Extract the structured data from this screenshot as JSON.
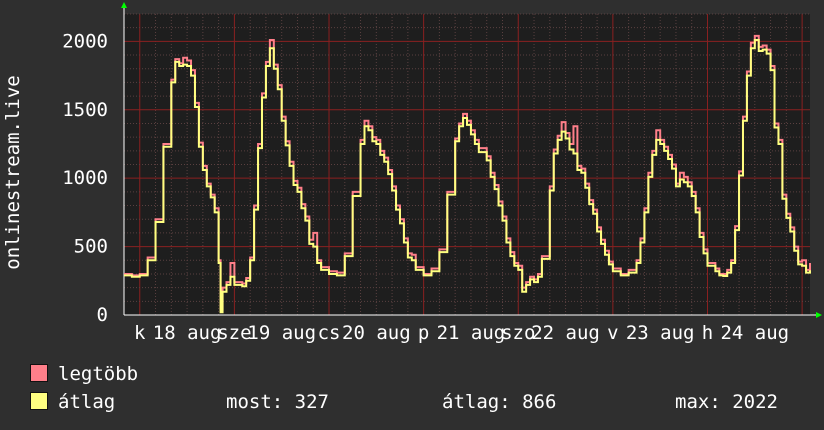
{
  "chart_data": {
    "type": "line",
    "ylabel": "onlinestream.live",
    "ylim": [
      0,
      2200
    ],
    "yticks": [
      0,
      500,
      1000,
      1500,
      2000
    ],
    "grid": true,
    "x_tick_labels": [
      "k",
      "18 aug",
      "sze",
      "19 aug",
      "cs",
      "20 aug",
      "p",
      "21 aug",
      "szo",
      "22 aug",
      "v",
      "23 aug",
      "h",
      "24 aug"
    ],
    "x_range_hours": [
      -4,
      164
    ],
    "series": [
      {
        "name": "legtöbb",
        "color": "#ff7f8a",
        "points": [
          [
            -4,
            300
          ],
          [
            -2,
            290
          ],
          [
            0,
            300
          ],
          [
            2,
            420
          ],
          [
            4,
            700
          ],
          [
            6,
            1250
          ],
          [
            8,
            1720
          ],
          [
            9,
            1870
          ],
          [
            10,
            1840
          ],
          [
            11,
            1880
          ],
          [
            12,
            1860
          ],
          [
            13,
            1790
          ],
          [
            14,
            1550
          ],
          [
            15,
            1260
          ],
          [
            16,
            1090
          ],
          [
            17,
            960
          ],
          [
            18,
            880
          ],
          [
            19,
            780
          ],
          [
            20,
            400
          ],
          [
            20.5,
            40
          ],
          [
            21,
            200
          ],
          [
            22,
            240
          ],
          [
            23,
            380
          ],
          [
            24,
            240
          ],
          [
            25,
            240
          ],
          [
            26,
            230
          ],
          [
            27,
            270
          ],
          [
            28,
            420
          ],
          [
            29,
            800
          ],
          [
            30,
            1250
          ],
          [
            31,
            1620
          ],
          [
            32,
            1850
          ],
          [
            33,
            2010
          ],
          [
            34,
            1830
          ],
          [
            35,
            1680
          ],
          [
            36,
            1450
          ],
          [
            37,
            1270
          ],
          [
            38,
            1120
          ],
          [
            39,
            980
          ],
          [
            40,
            930
          ],
          [
            41,
            810
          ],
          [
            42,
            720
          ],
          [
            43,
            550
          ],
          [
            44,
            600
          ],
          [
            45,
            400
          ],
          [
            46,
            350
          ],
          [
            48,
            320
          ],
          [
            50,
            310
          ],
          [
            52,
            450
          ],
          [
            54,
            900
          ],
          [
            56,
            1280
          ],
          [
            57,
            1420
          ],
          [
            58,
            1380
          ],
          [
            59,
            1300
          ],
          [
            60,
            1280
          ],
          [
            61,
            1200
          ],
          [
            62,
            1150
          ],
          [
            63,
            1060
          ],
          [
            64,
            940
          ],
          [
            65,
            800
          ],
          [
            66,
            700
          ],
          [
            67,
            560
          ],
          [
            68,
            450
          ],
          [
            69,
            440
          ],
          [
            70,
            350
          ],
          [
            72,
            300
          ],
          [
            74,
            340
          ],
          [
            76,
            480
          ],
          [
            78,
            900
          ],
          [
            80,
            1290
          ],
          [
            81,
            1400
          ],
          [
            82,
            1470
          ],
          [
            83,
            1420
          ],
          [
            84,
            1350
          ],
          [
            85,
            1280
          ],
          [
            86,
            1220
          ],
          [
            88,
            1160
          ],
          [
            89,
            1040
          ],
          [
            90,
            950
          ],
          [
            91,
            830
          ],
          [
            92,
            720
          ],
          [
            93,
            560
          ],
          [
            94,
            460
          ],
          [
            95,
            380
          ],
          [
            96,
            360
          ],
          [
            97,
            200
          ],
          [
            98,
            240
          ],
          [
            99,
            280
          ],
          [
            100,
            260
          ],
          [
            101,
            300
          ],
          [
            102,
            430
          ],
          [
            104,
            940
          ],
          [
            105,
            1210
          ],
          [
            106,
            1310
          ],
          [
            107,
            1410
          ],
          [
            108,
            1330
          ],
          [
            109,
            1250
          ],
          [
            110,
            1380
          ],
          [
            111,
            1090
          ],
          [
            112,
            1070
          ],
          [
            113,
            960
          ],
          [
            114,
            840
          ],
          [
            115,
            770
          ],
          [
            116,
            640
          ],
          [
            117,
            550
          ],
          [
            118,
            470
          ],
          [
            119,
            390
          ],
          [
            120,
            340
          ],
          [
            122,
            300
          ],
          [
            124,
            330
          ],
          [
            126,
            400
          ],
          [
            127,
            560
          ],
          [
            128,
            780
          ],
          [
            129,
            1040
          ],
          [
            130,
            1200
          ],
          [
            131,
            1350
          ],
          [
            132,
            1280
          ],
          [
            133,
            1230
          ],
          [
            134,
            1170
          ],
          [
            135,
            1100
          ],
          [
            136,
            960
          ],
          [
            137,
            1040
          ],
          [
            138,
            1010
          ],
          [
            139,
            970
          ],
          [
            140,
            900
          ],
          [
            141,
            780
          ],
          [
            142,
            600
          ],
          [
            143,
            480
          ],
          [
            144,
            380
          ],
          [
            146,
            340
          ],
          [
            147,
            300
          ],
          [
            148,
            300
          ],
          [
            149,
            330
          ],
          [
            150,
            400
          ],
          [
            151,
            650
          ],
          [
            152,
            1050
          ],
          [
            153,
            1450
          ],
          [
            154,
            1780
          ],
          [
            155,
            1990
          ],
          [
            156,
            2040
          ],
          [
            157,
            1960
          ],
          [
            158,
            1970
          ],
          [
            159,
            1940
          ],
          [
            160,
            1820
          ],
          [
            161,
            1400
          ],
          [
            162,
            1280
          ],
          [
            163,
            880
          ],
          [
            164,
            740
          ],
          [
            165,
            640
          ],
          [
            166,
            500
          ],
          [
            167,
            390
          ],
          [
            168,
            400
          ],
          [
            169,
            330
          ],
          [
            170,
            380
          ]
        ]
      },
      {
        "name": "átlag",
        "color": "#ffff80",
        "points": [
          [
            -4,
            290
          ],
          [
            -2,
            280
          ],
          [
            0,
            290
          ],
          [
            2,
            400
          ],
          [
            4,
            680
          ],
          [
            6,
            1230
          ],
          [
            8,
            1700
          ],
          [
            9,
            1850
          ],
          [
            10,
            1820
          ],
          [
            11,
            1830
          ],
          [
            12,
            1820
          ],
          [
            13,
            1750
          ],
          [
            14,
            1520
          ],
          [
            15,
            1230
          ],
          [
            16,
            1060
          ],
          [
            17,
            940
          ],
          [
            18,
            860
          ],
          [
            19,
            750
          ],
          [
            20,
            380
          ],
          [
            20.5,
            20
          ],
          [
            21,
            170
          ],
          [
            22,
            220
          ],
          [
            23,
            280
          ],
          [
            24,
            220
          ],
          [
            25,
            220
          ],
          [
            26,
            210
          ],
          [
            27,
            250
          ],
          [
            28,
            400
          ],
          [
            29,
            770
          ],
          [
            30,
            1220
          ],
          [
            31,
            1590
          ],
          [
            32,
            1820
          ],
          [
            33,
            1950
          ],
          [
            34,
            1800
          ],
          [
            35,
            1650
          ],
          [
            36,
            1420
          ],
          [
            37,
            1240
          ],
          [
            38,
            1090
          ],
          [
            39,
            950
          ],
          [
            40,
            900
          ],
          [
            41,
            780
          ],
          [
            42,
            690
          ],
          [
            43,
            520
          ],
          [
            44,
            500
          ],
          [
            45,
            380
          ],
          [
            46,
            330
          ],
          [
            48,
            300
          ],
          [
            50,
            290
          ],
          [
            52,
            430
          ],
          [
            54,
            870
          ],
          [
            56,
            1250
          ],
          [
            57,
            1380
          ],
          [
            58,
            1350
          ],
          [
            59,
            1270
          ],
          [
            60,
            1250
          ],
          [
            61,
            1170
          ],
          [
            62,
            1120
          ],
          [
            63,
            1030
          ],
          [
            64,
            910
          ],
          [
            65,
            770
          ],
          [
            66,
            670
          ],
          [
            67,
            530
          ],
          [
            68,
            420
          ],
          [
            69,
            400
          ],
          [
            70,
            330
          ],
          [
            72,
            290
          ],
          [
            74,
            320
          ],
          [
            76,
            460
          ],
          [
            78,
            880
          ],
          [
            80,
            1270
          ],
          [
            81,
            1380
          ],
          [
            82,
            1440
          ],
          [
            83,
            1390
          ],
          [
            84,
            1320
          ],
          [
            85,
            1250
          ],
          [
            86,
            1190
          ],
          [
            88,
            1130
          ],
          [
            89,
            1010
          ],
          [
            90,
            920
          ],
          [
            91,
            800
          ],
          [
            92,
            690
          ],
          [
            93,
            530
          ],
          [
            94,
            430
          ],
          [
            95,
            360
          ],
          [
            96,
            330
          ],
          [
            97,
            170
          ],
          [
            98,
            220
          ],
          [
            99,
            260
          ],
          [
            100,
            240
          ],
          [
            101,
            280
          ],
          [
            102,
            410
          ],
          [
            104,
            910
          ],
          [
            105,
            1180
          ],
          [
            106,
            1280
          ],
          [
            107,
            1340
          ],
          [
            108,
            1290
          ],
          [
            109,
            1210
          ],
          [
            110,
            1180
          ],
          [
            111,
            1060
          ],
          [
            112,
            1040
          ],
          [
            113,
            930
          ],
          [
            114,
            810
          ],
          [
            115,
            740
          ],
          [
            116,
            610
          ],
          [
            117,
            520
          ],
          [
            118,
            440
          ],
          [
            119,
            370
          ],
          [
            120,
            320
          ],
          [
            122,
            290
          ],
          [
            124,
            310
          ],
          [
            126,
            380
          ],
          [
            127,
            530
          ],
          [
            128,
            750
          ],
          [
            129,
            1010
          ],
          [
            130,
            1170
          ],
          [
            131,
            1280
          ],
          [
            132,
            1250
          ],
          [
            133,
            1200
          ],
          [
            134,
            1140
          ],
          [
            135,
            1070
          ],
          [
            136,
            940
          ],
          [
            137,
            990
          ],
          [
            138,
            970
          ],
          [
            139,
            940
          ],
          [
            140,
            870
          ],
          [
            141,
            750
          ],
          [
            142,
            570
          ],
          [
            143,
            450
          ],
          [
            144,
            360
          ],
          [
            146,
            320
          ],
          [
            147,
            290
          ],
          [
            148,
            285
          ],
          [
            149,
            310
          ],
          [
            150,
            380
          ],
          [
            151,
            620
          ],
          [
            152,
            1020
          ],
          [
            153,
            1420
          ],
          [
            154,
            1750
          ],
          [
            155,
            1950
          ],
          [
            156,
            2010
          ],
          [
            157,
            1930
          ],
          [
            158,
            1940
          ],
          [
            159,
            1910
          ],
          [
            160,
            1790
          ],
          [
            161,
            1370
          ],
          [
            162,
            1250
          ],
          [
            163,
            850
          ],
          [
            164,
            710
          ],
          [
            165,
            610
          ],
          [
            166,
            470
          ],
          [
            167,
            370
          ],
          [
            168,
            360
          ],
          [
            169,
            310
          ],
          [
            170,
            327
          ]
        ]
      }
    ]
  },
  "legend": {
    "max_label": "legtöbb",
    "avg_label": "átlag",
    "max_color": "#ff7f8a",
    "avg_color": "#ffff80"
  },
  "stats": {
    "now": "most: 327",
    "average": "átlag: 866",
    "max": "max: 2022"
  }
}
